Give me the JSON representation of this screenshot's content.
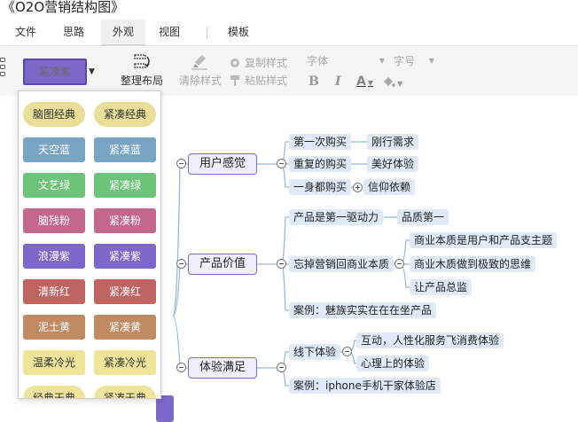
{
  "app": {
    "title": "《O2O营销结构图》"
  },
  "menu": {
    "items": [
      "文件",
      "思路",
      "外观",
      "视图",
      "模板"
    ],
    "active": "外观"
  },
  "toolbar": {
    "theme_button": "紧凑紫",
    "arrange_label": "整理布局",
    "clear_style_label": "清除样式",
    "copy_style_label": "复制样式",
    "paste_style_label": "粘贴样式",
    "font_placeholder": "字体",
    "size_placeholder": "字号",
    "bold": "B",
    "italic": "I",
    "font_color": "A"
  },
  "themes": [
    {
      "left": "脑图经典",
      "right": "紧凑经典",
      "lbg": "#e9df98",
      "rbg": "#e9df98",
      "lfg": "#333333",
      "rfg": "#333333",
      "pill": true
    },
    {
      "left": "天空蓝",
      "right": "紧凑蓝",
      "lbg": "#79a5c4",
      "rbg": "#79a5c4",
      "lfg": "#ffffff",
      "rfg": "#ffffff",
      "pill": false
    },
    {
      "left": "文艺绿",
      "right": "紧凑绿",
      "lbg": "#6dc37a",
      "rbg": "#6dc37a",
      "lfg": "#ffffff",
      "rfg": "#ffffff",
      "pill": false
    },
    {
      "left": "脑残粉",
      "right": "紧凑粉",
      "lbg": "#c4678d",
      "rbg": "#c4678d",
      "lfg": "#ffffff",
      "rfg": "#ffffff",
      "pill": false
    },
    {
      "left": "浪漫紫",
      "right": "紧凑紫",
      "lbg": "#7b68c9",
      "rbg": "#7b68c9",
      "lfg": "#ffffff",
      "rfg": "#ffffff",
      "pill": false
    },
    {
      "left": "清新红",
      "right": "紧凑红",
      "lbg": "#c06462",
      "rbg": "#c06462",
      "lfg": "#ffffff",
      "rfg": "#ffffff",
      "pill": false
    },
    {
      "left": "泥土黄",
      "right": "紧凑黄",
      "lbg": "#c08a63",
      "rbg": "#c08a63",
      "lfg": "#ffffff",
      "rfg": "#ffffff",
      "pill": false
    },
    {
      "left": "温柔冷光",
      "right": "紧凑冷光",
      "lbg": "#efe59a",
      "rbg": "#efe59a",
      "lfg": "#333333",
      "rfg": "#333333",
      "pill": false
    },
    {
      "left": "经典天典",
      "right": "紧凑天典",
      "lbg": "#efe59a",
      "rbg": "#efe59a",
      "lfg": "#333333",
      "rfg": "#333333",
      "pill": true
    }
  ],
  "mindmap": {
    "branches": [
      {
        "label": "用户感觉",
        "children": [
          {
            "label": "第一次购买",
            "children": [
              "刚行需求"
            ]
          },
          {
            "label": "重复的购买",
            "children": [
              "美好体验"
            ]
          },
          {
            "label": "一身都购买",
            "children": [
              "信仰依赖"
            ]
          }
        ]
      },
      {
        "label": "产品价值",
        "children": [
          {
            "label": "产品是第一驱动力",
            "children": [
              "品质第一"
            ]
          },
          {
            "label": "忘掉营销回商业本质",
            "children": [
              "商业本质是用户和产品支主题",
              "商业木质做到极致的思维",
              "让产品总监"
            ]
          },
          {
            "label": "案例：魅族实实在在在坐产品",
            "children": []
          }
        ]
      },
      {
        "label": "体验满足",
        "children": [
          {
            "label": "线下体验",
            "children": [
              "互动，人性化服务飞消费体验",
              "心理上的体验"
            ]
          },
          {
            "label": "案例：iphone手机干家体验店",
            "children": []
          }
        ]
      }
    ]
  },
  "colors": {
    "accent": "#7b68c9",
    "node_bg": "#dfe9f8",
    "branch_border": "#7e6cc6",
    "line": "#9bb8dd"
  }
}
